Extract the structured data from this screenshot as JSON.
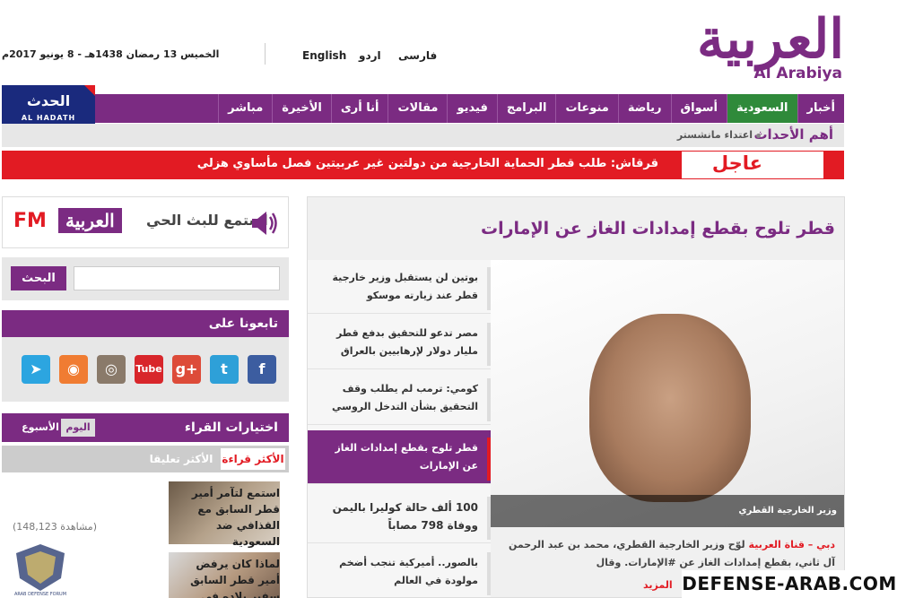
{
  "header": {
    "date": "الخميس 13 رمضان 1438هـ - 8 يونيو 2017م",
    "languages": {
      "en": "English",
      "ur": "اردو",
      "fa": "فارسی"
    },
    "logo_ar": "العربية",
    "logo_en": "Al Arabiya"
  },
  "hadath": {
    "ar": "الحدث",
    "en": "AL HADATH"
  },
  "nav": {
    "items": [
      "أخبار",
      "السعودية",
      "أسواق",
      "رياضة",
      "منوعات",
      "البرامج",
      "فيديو",
      "مقالات",
      "أنا أرى",
      "الأخيرة",
      "مباشر"
    ],
    "active_index": 1
  },
  "trending": {
    "title": "أهم الأحداث",
    "item": "اعتداء مانشستر"
  },
  "breaking": {
    "label": "عاجل",
    "text": "قرقاش: طلب قطر الحماية الخارجية من دولتين غير عربيتين فصل مأساوي هزلي"
  },
  "fm": {
    "listen": "استمع للبث الحي",
    "brand_ar": "العربية",
    "brand_fm": "FM"
  },
  "search": {
    "button": "البحث",
    "placeholder": ""
  },
  "follow": {
    "title": "تابعونا على",
    "icons": [
      {
        "name": "telegram-icon",
        "glyph": "➤",
        "color": "#2ca5e0"
      },
      {
        "name": "rss-icon",
        "glyph": "◉",
        "color": "#f07c32"
      },
      {
        "name": "instagram-icon",
        "glyph": "◎",
        "color": "#8a7a6a"
      },
      {
        "name": "youtube-icon",
        "glyph": "Tube",
        "color": "#d8262b"
      },
      {
        "name": "googleplus-icon",
        "glyph": "g+",
        "color": "#dd4b39"
      },
      {
        "name": "twitter-icon",
        "glyph": "t",
        "color": "#2ea0d8"
      },
      {
        "name": "facebook-icon",
        "glyph": "f",
        "color": "#3c5da0"
      }
    ]
  },
  "most_read": {
    "title": "اختيارات القراء",
    "tab_today": "اليوم",
    "tab_week": "الأسبوع",
    "tab_most_read": "الأكثر قراءة",
    "tab_most_commented": "الأكثر تعليقا",
    "items": [
      {
        "text": "استمع لتآمر أمير قطر السابق مع القذافي ضد السعودية",
        "views": "(148,123 مشاهدة)"
      },
      {
        "text": "لماذا كان يرفض أمير قطر السابق سفير بلاده في مصر؟",
        "views": ""
      }
    ]
  },
  "main": {
    "title": "قطر تلوح بقطع إمدادات الغاز عن الإمارات",
    "photo_caption": "وزير الخارجية القطري",
    "related": [
      "بوتين لن يستقبل وزير خارجية قطر عند زيارته موسكو",
      "مصر تدعو للتحقيق بدفع قطر مليار دولار لإرهابيين بالعراق",
      "كومي: ترمب لم يطلب وقف التحقيق بشأن التدخل الروسي",
      "قطر تلوح بقطع إمدادات الغاز عن الإمارات",
      "100 ألف حالة كوليرا باليمن ووفاة 798 مصاباً",
      "بالصور.. أميركية تنجب أضخم مولودة في العالم"
    ],
    "active_related": 3,
    "lead_source": "دبي – قناة العربية",
    "lead_text": " لوّح وزير الخارجية القطري، محمد بن عبد الرحمن آل ثاني، بقطع إمدادات الغاز عن #الإمارات. وقال #وزير_الخارجية_القطري في",
    "more": "المزيد"
  },
  "watermark": {
    "text": "DEFENSE-ARAB.COM",
    "shield_text": "ARAB DEFENSE FORUM"
  }
}
